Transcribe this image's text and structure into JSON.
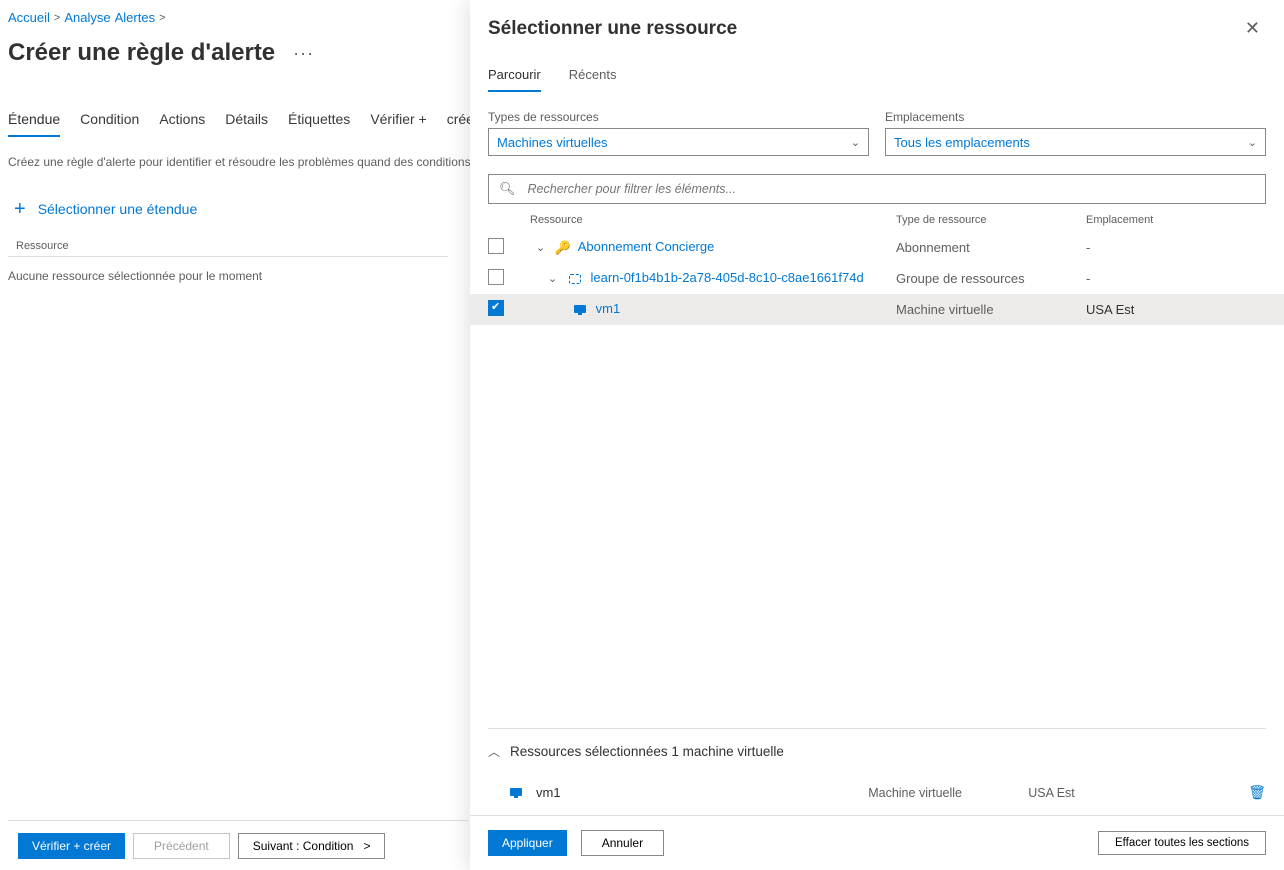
{
  "breadcrumbs": {
    "home": "Accueil",
    "analyse": "Analyse",
    "alertes": "Alertes"
  },
  "page": {
    "title": "Créer une règle d'alerte",
    "tabs": {
      "scope": "Étendue",
      "condition": "Condition",
      "actions": "Actions",
      "details": "Détails",
      "tags": "Étiquettes",
      "review": "Vérifier +",
      "create": "créer"
    },
    "helper": "Créez une règle d'alerte pour identifier et résoudre les problèmes quand des conditions importantes",
    "select_scope": "Sélectionner une étendue",
    "resource_header": "Ressource",
    "no_resource": "Aucune ressource sélectionnée pour le moment",
    "btn_review": "Vérifier +   créer",
    "btn_prev": "Précédent",
    "btn_next": "Suivant :  Condition"
  },
  "panel": {
    "title": "Sélectionner une ressource",
    "tab_browse": "Parcourir",
    "tab_recent": "Récents",
    "filter_type_label": "Types de ressources",
    "filter_type_value": "Machines virtuelles",
    "filter_loc_label": "Emplacements",
    "filter_loc_value": "Tous les emplacements",
    "search_placeholder": "Rechercher pour filtrer les éléments...",
    "col_res": "Ressource",
    "col_type": "Type de ressource",
    "col_loc": "Emplacement",
    "rows": [
      {
        "name": "Abonnement Concierge",
        "type": "Abonnement",
        "loc": "-"
      },
      {
        "name": "learn-0f1b4b1b-2a78-405d-8c10-c8ae1661f74d",
        "type": "Groupe de ressources",
        "loc": "-"
      },
      {
        "name": "vm1",
        "type": "Machine virtuelle",
        "loc": "USA Est"
      }
    ],
    "summary_label": "Ressources sélectionnées 1 machine virtuelle",
    "selected": {
      "name": "vm1",
      "type": "Machine virtuelle",
      "loc": "USA Est"
    },
    "btn_apply": "Appliquer",
    "btn_cancel": "Annuler",
    "btn_clear": "Effacer toutes les sections"
  }
}
